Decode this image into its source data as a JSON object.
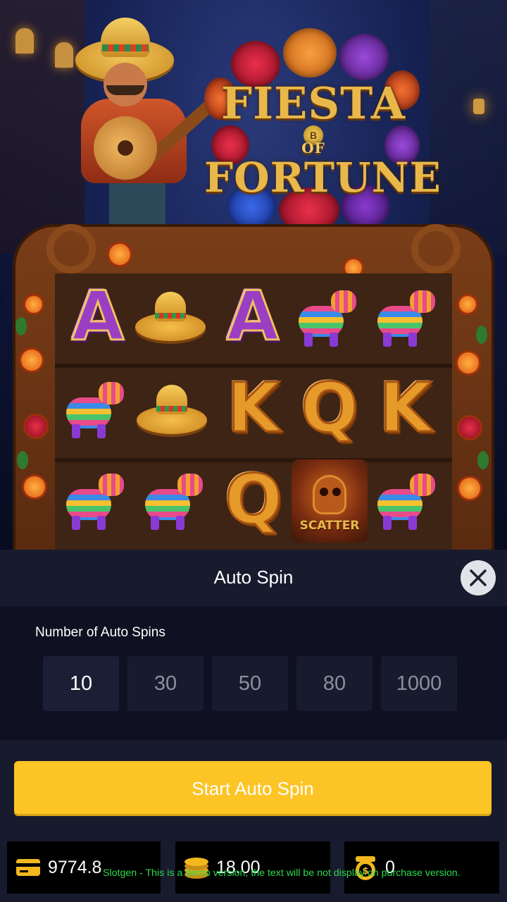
{
  "game": {
    "logo_line1": "FIESTA",
    "logo_line2": "OF",
    "logo_line3": "FORTUNE",
    "coin_symbol": "B",
    "reels": [
      [
        "A",
        "sombrero-icon",
        "A",
        "pinata-icon",
        "pinata-icon"
      ],
      [
        "pinata-icon",
        "sombrero-icon",
        "K",
        "Q",
        "K"
      ],
      [
        "pinata-icon",
        "pinata-icon",
        "Q",
        "scatter-icon",
        "pinata-icon"
      ]
    ],
    "scatter_label": "SCATTER",
    "letter_a": "A",
    "letter_k": "K",
    "letter_q": "Q"
  },
  "auto_spin": {
    "title": "Auto Spin",
    "close_icon": "close-icon",
    "count_label": "Number of Auto Spins",
    "options": [
      "10",
      "30",
      "50",
      "80",
      "1000"
    ],
    "selected": "10",
    "start_label": "Start Auto Spin"
  },
  "status_bar": {
    "balance": "9774.8",
    "balance_icon": "wallet-icon",
    "bet": "18.00",
    "bet_icon": "coin-stack-icon",
    "win": "0",
    "win_icon": "win-coin-icon"
  },
  "demo_note": "Slotgen - This is a demo version, the text will be not display on purchase version.",
  "colors": {
    "accent_yellow": "#fcc425",
    "panel_bg": "#181b2e",
    "demo_green": "#2cdc4c"
  }
}
